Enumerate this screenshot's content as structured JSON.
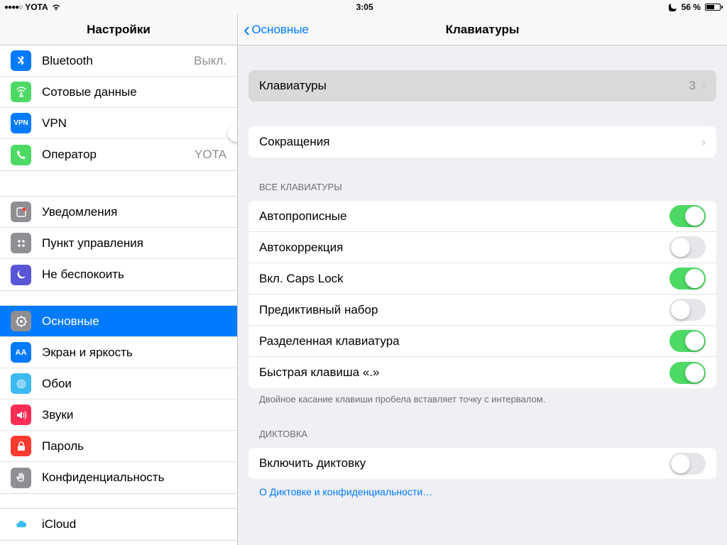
{
  "status": {
    "carrier": "YOTA",
    "signal_dots": "●●●●○",
    "time": "3:05",
    "battery_pct": "56 %"
  },
  "sidebar": {
    "title": "Настройки",
    "g1": [
      {
        "label": "Bluetooth",
        "value": "Выкл."
      },
      {
        "label": "Сотовые данные"
      },
      {
        "label": "VPN"
      },
      {
        "label": "Оператор",
        "value": "YOTA"
      }
    ],
    "g2": [
      {
        "label": "Уведомления"
      },
      {
        "label": "Пункт управления"
      },
      {
        "label": "Не беспокоить"
      }
    ],
    "g3": [
      {
        "label": "Основные"
      },
      {
        "label": "Экран и яркость"
      },
      {
        "label": "Обои"
      },
      {
        "label": "Звуки"
      },
      {
        "label": "Пароль"
      },
      {
        "label": "Конфиденциальность"
      }
    ],
    "g4": [
      {
        "label": "iCloud"
      }
    ]
  },
  "header": {
    "back": "Основные",
    "title": "Клавиатуры"
  },
  "detail": {
    "keyboards_row": {
      "label": "Клавиатуры",
      "value": "3"
    },
    "shortcuts_row": {
      "label": "Сокращения"
    },
    "all_header": "ВСЕ КЛАВИАТУРЫ",
    "toggles": [
      {
        "label": "Автопрописные",
        "on": true
      },
      {
        "label": "Автокоррекция",
        "on": false
      },
      {
        "label": "Вкл. Caps Lock",
        "on": true
      },
      {
        "label": "Предиктивный набор",
        "on": false
      },
      {
        "label": "Разделенная клавиатура",
        "on": true
      },
      {
        "label": "Быстрая клавиша «.»",
        "on": true
      }
    ],
    "toggles_footer": "Двойное касание клавиши пробела вставляет точку с интервалом.",
    "dict_header": "ДИКТОВКА",
    "dict_row": {
      "label": "Включить диктовку",
      "on": false
    },
    "dict_link": "О Диктовке и конфиденциальности…"
  }
}
